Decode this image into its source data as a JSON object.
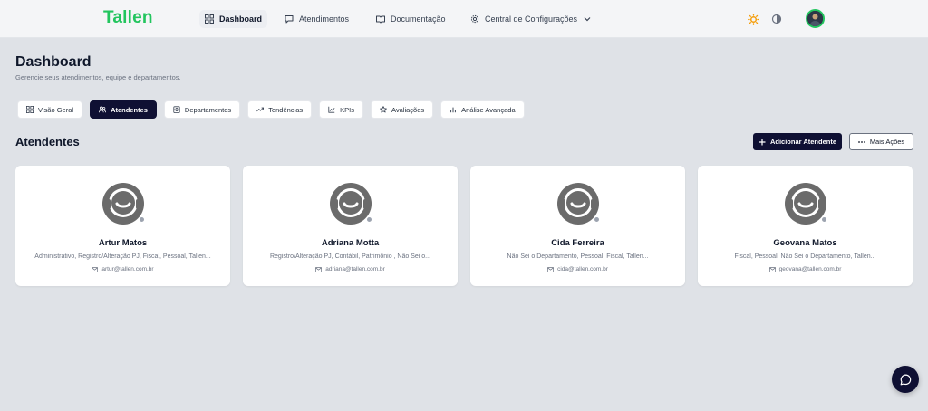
{
  "brand": {
    "logo_text": "Tallen",
    "accent": "#22c55e"
  },
  "nav": {
    "dashboard": "Dashboard",
    "atendimentos": "Atendimentos",
    "documentacao": "Documentação",
    "config": "Central de Configurações"
  },
  "page": {
    "title": "Dashboard",
    "subtitle": "Gerencie seus atendimentos, equipe e departamentos."
  },
  "tabs": [
    {
      "label": "Visão Geral",
      "icon": "grid-icon",
      "active": false
    },
    {
      "label": "Atendentes",
      "icon": "users-icon",
      "active": true
    },
    {
      "label": "Departamentos",
      "icon": "building-icon",
      "active": false
    },
    {
      "label": "Tendências",
      "icon": "trending-up-icon",
      "active": false
    },
    {
      "label": "KPIs",
      "icon": "line-chart-icon",
      "active": false
    },
    {
      "label": "Avaliações",
      "icon": "star-icon",
      "active": false
    },
    {
      "label": "Análise Avançada",
      "icon": "bar-chart-icon",
      "active": false
    }
  ],
  "section": {
    "title": "Atendentes",
    "add_button": "Adicionar Atendente",
    "more_button": "Mais Ações"
  },
  "agents": [
    {
      "name": "Artur Matos",
      "departments": "Administrativo, Registro/Alteração PJ, Fiscal, Pessoal, Tallen...",
      "email": "artur@tallen.com.br",
      "status": "offline"
    },
    {
      "name": "Adriana Motta",
      "departments": "Registro/Alteração PJ, Contábil, Patrimônio , Não Sei o...",
      "email": "adriana@tallen.com.br",
      "status": "offline"
    },
    {
      "name": "Cida Ferreira",
      "departments": "Não Sei o Departamento, Pessoal, Fiscal, Tallen...",
      "email": "cida@tallen.com.br",
      "status": "offline"
    },
    {
      "name": "Geovana Matos",
      "departments": "Fiscal, Pessoal, Não Sei o Departamento, Tallen...",
      "email": "geovana@tallen.com.br",
      "status": "offline"
    }
  ],
  "colors": {
    "primary": "#0f1033",
    "background": "#dfe2e7",
    "status_offline": "#9ca3af",
    "sun": "#f59e0b"
  }
}
